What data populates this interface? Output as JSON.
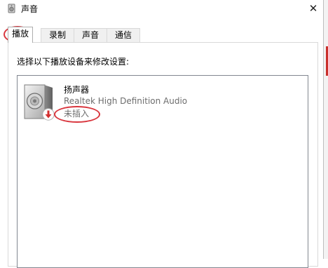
{
  "window": {
    "title": "声音",
    "icon": "speaker-icon",
    "close_glyph": "✕"
  },
  "tabs": [
    {
      "label": "播放",
      "active": true
    },
    {
      "label": "录制",
      "active": false
    },
    {
      "label": "声音",
      "active": false
    },
    {
      "label": "通信",
      "active": false
    }
  ],
  "instruction": "选择以下播放设备来修改设置:",
  "devices": [
    {
      "name": "扬声器",
      "description": "Realtek High Definition Audio",
      "status": "未插入",
      "icon": "speaker-icon",
      "status_icon": "unplugged-arrow-icon"
    }
  ],
  "colors": {
    "annotation": "#d9363e",
    "status_badge": "#d32f2f"
  }
}
